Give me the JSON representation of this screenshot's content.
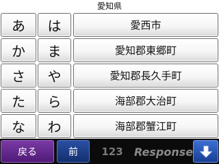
{
  "header": {
    "title": "愛知県"
  },
  "kana_column_1": [
    "あ",
    "か",
    "さ",
    "た",
    "な"
  ],
  "kana_column_2": [
    "は",
    "ま",
    "や",
    "ら",
    "わ"
  ],
  "cities": [
    "愛西市",
    "愛知郡東郷町",
    "愛知郡長久手町",
    "海部郡大治町",
    "海部郡蟹江町"
  ],
  "footer": {
    "back_label": "戻る",
    "prev_label": "前",
    "count": "123",
    "logo_text": "Response",
    "down_icon": "down-arrow-icon"
  }
}
